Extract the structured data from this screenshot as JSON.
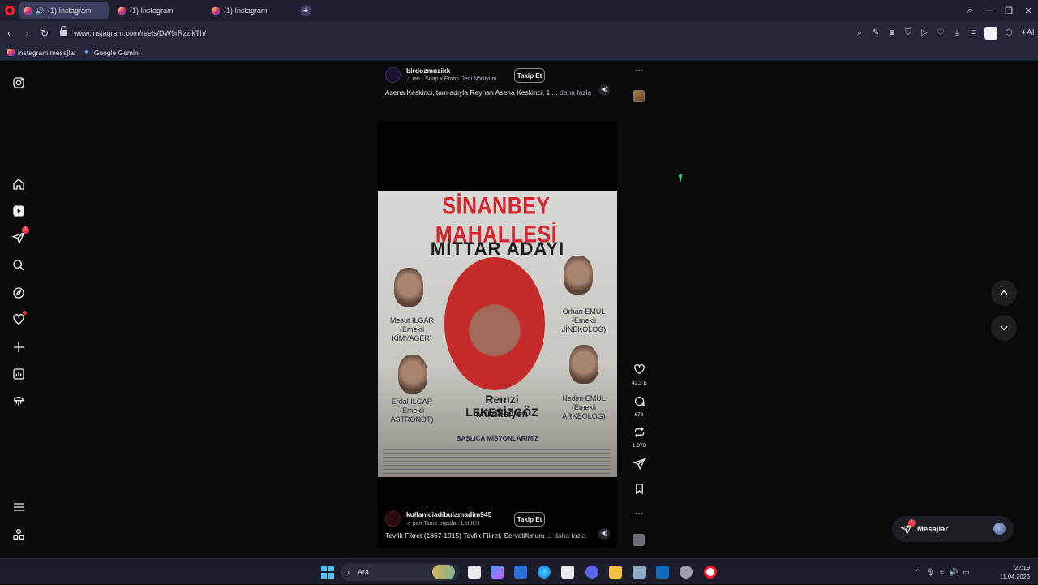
{
  "browser": {
    "tabs": [
      {
        "label": "(1) Instagram",
        "active": true,
        "audio": true
      },
      {
        "label": "(1) Instagram",
        "active": false,
        "audio": false
      },
      {
        "label": "(1) Instagram",
        "active": false,
        "audio": false
      }
    ],
    "url": "www.instagram.com/reels/DW9rRzzjkTh/",
    "ai_label": "AI",
    "bookmarks": [
      {
        "label": "instagram mesajlar",
        "icon": "instagram-icon"
      },
      {
        "label": "Google Gemini",
        "icon": "gemini-icon"
      }
    ]
  },
  "sidebar": {
    "notification_count": "1"
  },
  "reel_top": {
    "username": "birdozmuzikk",
    "music": "ıan - Snap x Emmi Dedi Nörüyüm",
    "follow_label": "Takip Et",
    "caption": "Asena Keskinci, tam adıyla Reyhan Asena Keskinci, 1 ...",
    "more_label": "daha fazla"
  },
  "reel_main": {
    "poster": {
      "title": "SİNANBEY MAHALLESİ",
      "subtitle": "MİTTAR ADAYI",
      "people": [
        {
          "name": "Mesut ILGAR",
          "role": "(Emekli KİMYAGER)"
        },
        {
          "name": "Orhan EMUL",
          "role": "(Emekli JİNEKOLOG)"
        },
        {
          "name": "Erdal ILGAR",
          "role": "(Emekli ASTRONOT)"
        },
        {
          "name": "Nedim EMUL",
          "role": "(Emekli ARKEOLOG)"
        }
      ],
      "candidate_name": "Remzi LEKESİZGÖZ",
      "candidate_role": "Müziksiyen",
      "missions": "BAŞLICA MİSYONLARIMIZ"
    },
    "username": "kullaniciadibulamadim945",
    "music": "pen        Tame Impala · Let It H",
    "follow_label": "Takip Et",
    "caption": "Tevfik Fikret (1867-1915) Tevfik Fikret, Servetifünunı ...",
    "more_label": "daha fazla",
    "likes": "42,3 B",
    "comments": "678",
    "reposts": "1.378"
  },
  "messages": {
    "label": "Mesajlar",
    "badge": "1"
  },
  "taskbar": {
    "search_placeholder": "Ara",
    "time": "22:19",
    "date": "11.04.2026"
  },
  "colors": {
    "accent_red": "#ff3040",
    "tab_active": "#3b3e5c",
    "chrome_bg": "#24263a"
  }
}
